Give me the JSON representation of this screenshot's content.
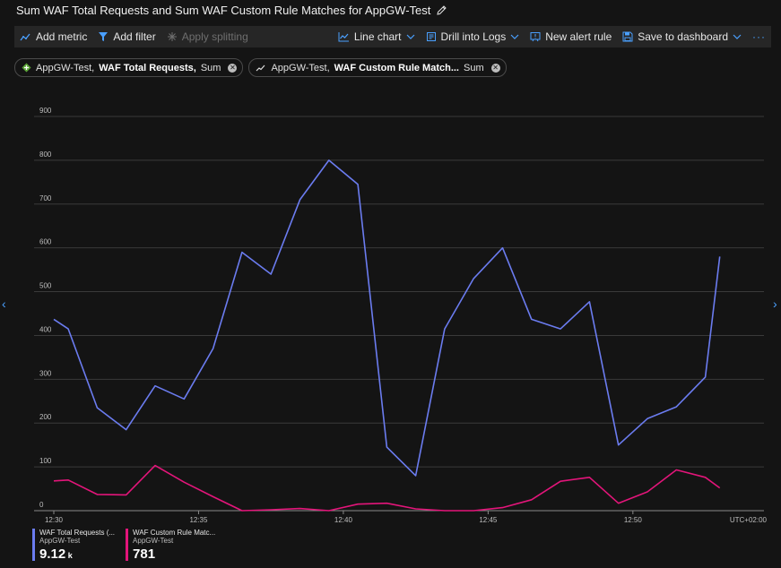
{
  "title": "Sum WAF Total Requests and Sum WAF Custom Rule Matches for AppGW-Test",
  "toolbar": {
    "add_metric": "Add metric",
    "add_filter": "Add filter",
    "apply_splitting": "Apply splitting",
    "line_chart": "Line chart",
    "drill_into_logs": "Drill into Logs",
    "new_alert_rule": "New alert rule",
    "save_to_dashboard": "Save to dashboard",
    "more": "···"
  },
  "chips": [
    {
      "resource": "AppGW-Test,",
      "metric": "WAF Total Requests,",
      "agg": "Sum"
    },
    {
      "resource": "AppGW-Test,",
      "metric": "WAF Custom Rule Match...",
      "agg": "Sum"
    }
  ],
  "legend": [
    {
      "name": "WAF Total Requests (...",
      "resource": "AppGW-Test",
      "value": "9.12",
      "unit": "k",
      "color": "#6b7cf0"
    },
    {
      "name": "WAF Custom Rule Matc...",
      "resource": "AppGW-Test",
      "value": "781",
      "unit": "",
      "color": "#e3157a"
    }
  ],
  "chart_data": {
    "type": "line",
    "ylim": [
      0,
      900
    ],
    "yticks": [
      0,
      100,
      200,
      300,
      400,
      500,
      600,
      700,
      800,
      900
    ],
    "xlim": [
      0,
      24
    ],
    "xticks": [
      {
        "x": 0,
        "label": "12:30"
      },
      {
        "x": 5,
        "label": "12:35"
      },
      {
        "x": 10,
        "label": "12:40"
      },
      {
        "x": 15,
        "label": "12:45"
      },
      {
        "x": 20,
        "label": "12:50"
      }
    ],
    "timezone": "UTC+02:00",
    "series": [
      {
        "name": "WAF Total Requests",
        "color": "#6b7cf0",
        "x": [
          0,
          0.5,
          1.5,
          2.5,
          3.5,
          4.5,
          5.5,
          6.5,
          7.5,
          8.5,
          9.5,
          10.5,
          11.5,
          12.5,
          13.5,
          14.5,
          15.5,
          16.5,
          17.5,
          18.5,
          19.5,
          20.5,
          21.5,
          22.5,
          23
        ],
        "y": [
          437,
          415,
          235,
          185,
          285,
          255,
          370,
          590,
          540,
          710,
          800,
          745,
          145,
          80,
          415,
          530,
          600,
          437,
          415,
          477,
          150,
          210,
          237,
          305,
          580
        ]
      },
      {
        "name": "WAF Custom Rule Matches",
        "color": "#e3157a",
        "x": [
          0,
          0.5,
          1.5,
          2.5,
          3.5,
          4.5,
          5.5,
          6.5,
          7.5,
          8.5,
          9.5,
          10.5,
          11.5,
          12.5,
          13.5,
          14.5,
          15.5,
          16.5,
          17.5,
          18.5,
          19.5,
          20.5,
          21.5,
          22.5,
          23
        ],
        "y": [
          68,
          70,
          37,
          36,
          103,
          65,
          32,
          0,
          2,
          5,
          0,
          15,
          17,
          4,
          0,
          0,
          7,
          25,
          67,
          76,
          17,
          43,
          93,
          76,
          52
        ]
      }
    ]
  }
}
